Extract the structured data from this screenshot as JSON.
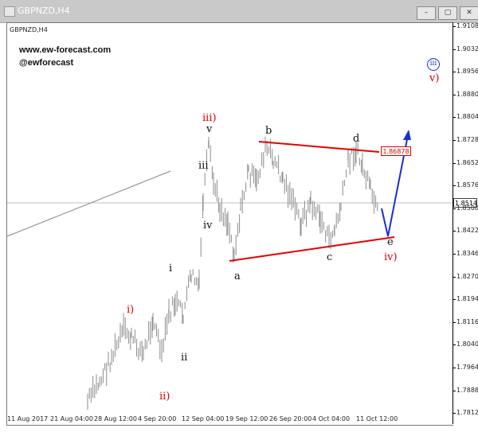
{
  "window": {
    "title": "GBPNZD,H4",
    "controls": {
      "minimize": "–",
      "restore": "▢",
      "close": "✕"
    }
  },
  "chart": {
    "symbol_label": "GBPNZD,H4",
    "website": "www.ew-forecast.com",
    "handle": "@ewforecast",
    "current_price": "1.8514",
    "level_label": "1.86878",
    "y_labels": [
      "1.9108",
      "1.9032",
      "1.8956",
      "1.8880",
      "1.8804",
      "1.8728",
      "1.8652",
      "1.8576",
      "1.8500",
      "1.8422",
      "1.8346",
      "1.8270",
      "1.8194",
      "1.8116",
      "1.8040",
      "1.7964",
      "1.7888",
      "1.7812"
    ],
    "x_labels": [
      "11 Aug 2017",
      "21 Aug 04:00",
      "28 Aug 12:00",
      "4 Sep 20:00",
      "12 Sep 04:00",
      "19 Sep 12:00",
      "26 Sep 20:00",
      "4 Oct 04:00",
      "11 Oct 12:00"
    ],
    "wave_labels": {
      "major_i": "i)",
      "major_ii": "ii)",
      "major_iii": "iii)",
      "major_iv": "iv)",
      "major_v": "v)",
      "minor_i": "i",
      "minor_ii": "ii",
      "minor_iii": "iii",
      "minor_iv": "iv",
      "minor_v": "v",
      "tri_a": "a",
      "tri_b": "b",
      "tri_c": "c",
      "tri_d": "d",
      "tri_e": "e",
      "circle_iii": "iii"
    },
    "colors": {
      "triangle": "#e60000",
      "projection": "#1a2fd8",
      "candles": "#8c8c8c"
    }
  }
}
